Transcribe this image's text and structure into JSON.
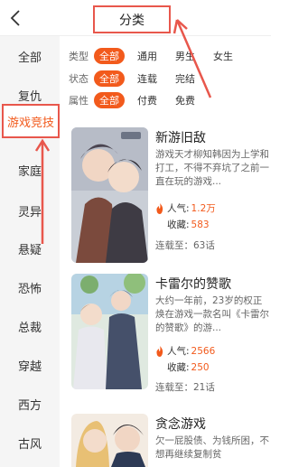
{
  "header": {
    "title": "分类",
    "back_icon": "chevron-left-icon"
  },
  "sidebar": {
    "items": [
      {
        "label": "全部"
      },
      {
        "label": "复仇"
      },
      {
        "label": "游戏竞技",
        "active": true
      },
      {
        "label": "家庭"
      },
      {
        "label": "灵异"
      },
      {
        "label": "悬疑"
      },
      {
        "label": "恐怖"
      },
      {
        "label": "总裁"
      },
      {
        "label": "穿越"
      },
      {
        "label": "西方"
      },
      {
        "label": "古风"
      }
    ]
  },
  "filters": [
    {
      "label": "类型",
      "options": [
        "全部",
        "通用",
        "男生",
        "女生"
      ],
      "selected": "全部"
    },
    {
      "label": "状态",
      "options": [
        "全部",
        "连载",
        "完结"
      ],
      "selected": "全部"
    },
    {
      "label": "属性",
      "options": [
        "全部",
        "付费",
        "免费"
      ],
      "selected": "全部"
    }
  ],
  "comics": [
    {
      "title": "新游旧敌",
      "desc": "游戏天才柳知韩因为上学和打工，不得不弃坑了之前一直在玩的游戏...",
      "popularity_label": "人气:",
      "popularity": "1.2万",
      "collect_label": "收藏:",
      "collect": "583",
      "serial": "连载至：63话"
    },
    {
      "title": "卡雷尔的赞歌",
      "desc": "大约一年前，23岁的权正焕在游戏一款名叫《卡雷尔的赞歌》的游...",
      "popularity_label": "人气:",
      "popularity": "2566",
      "collect_label": "收藏:",
      "collect": "250",
      "serial": "连载至：21话"
    },
    {
      "title": "贪念游戏",
      "desc": "欠一屁股债、为钱所困，不想再继续复制贫",
      "popularity_label": "",
      "popularity": "",
      "collect_label": "",
      "collect": "",
      "serial": ""
    }
  ],
  "colors": {
    "accent": "#f25a1c",
    "annotation": "#e8574c",
    "sidebar_bg": "#f5f5f5"
  }
}
